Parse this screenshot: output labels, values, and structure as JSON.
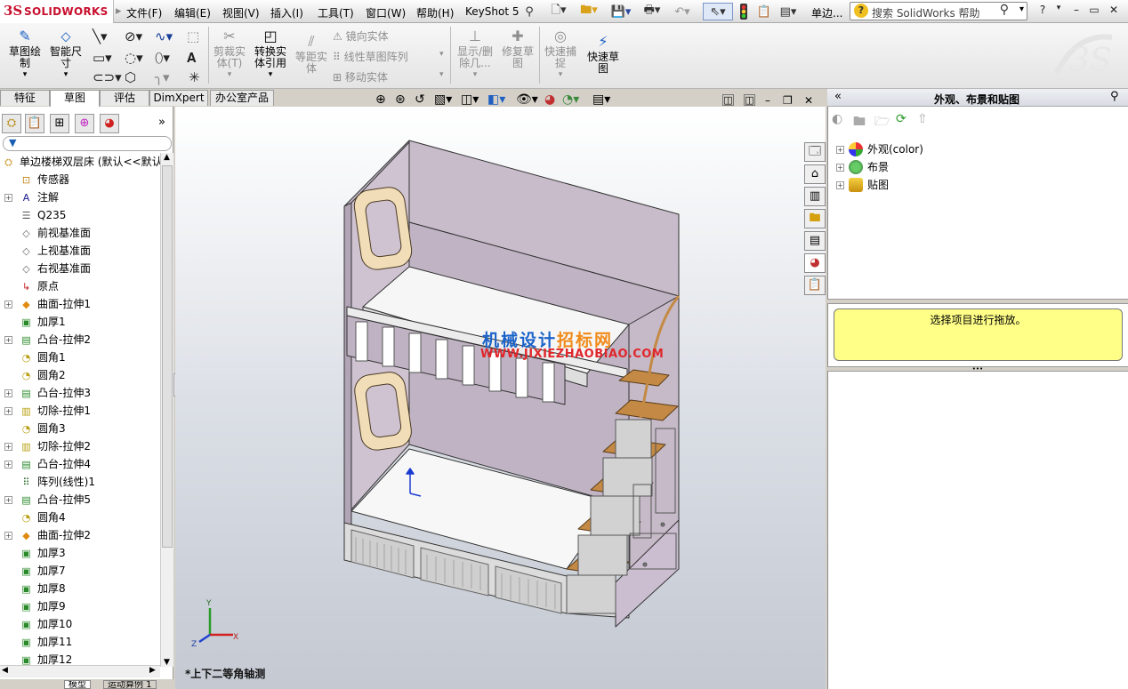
{
  "app": {
    "logo_mark": "3S",
    "logo_text": "SOLIDWORKS"
  },
  "menu": [
    "文件(F)",
    "编辑(E)",
    "视图(V)",
    "插入(I)",
    "工具(T)",
    "窗口(W)",
    "帮助(H)",
    "KeyShot 5"
  ],
  "toolbar": {
    "model_name_short": "单边...",
    "search_placeholder": "搜索 SolidWorks 帮助"
  },
  "command_manager": {
    "sketch": "草图绘\n制",
    "smart_dim": "智能尺\n寸",
    "trim": "剪裁实\n体(T)",
    "convert": "转换实\n体引用",
    "offset": "等距实\n体",
    "mirror": "镜向实体",
    "linear_pattern": "线性草图阵列",
    "move": "移动实体",
    "show_delete": "显示/删\n除几...",
    "repair": "修复草\n图",
    "quick_snap": "快速捕\n捉",
    "rapid_sketch": "快速草\n图"
  },
  "tabs": [
    "特征",
    "草图",
    "评估",
    "DimXpert",
    "办公室产品"
  ],
  "active_tab": 1,
  "tree": {
    "root": "单边楼梯双层床  (默认<<默认",
    "items": [
      {
        "label": "传感器",
        "exp": false,
        "icon": "sensor-icon"
      },
      {
        "label": "注解",
        "exp": true,
        "icon": "annotation-icon"
      },
      {
        "label": "Q235",
        "exp": false,
        "icon": "material-icon"
      },
      {
        "label": "前视基准面",
        "exp": false,
        "icon": "plane-icon"
      },
      {
        "label": "上视基准面",
        "exp": false,
        "icon": "plane-icon"
      },
      {
        "label": "右视基准面",
        "exp": false,
        "icon": "plane-icon"
      },
      {
        "label": "原点",
        "exp": false,
        "icon": "origin-icon"
      },
      {
        "label": "曲面-拉伸1",
        "exp": true,
        "icon": "surface-extrude-icon"
      },
      {
        "label": "加厚1",
        "exp": false,
        "icon": "thicken-icon"
      },
      {
        "label": "凸台-拉伸2",
        "exp": true,
        "icon": "boss-extrude-icon"
      },
      {
        "label": "圆角1",
        "exp": false,
        "icon": "fillet-icon"
      },
      {
        "label": "圆角2",
        "exp": false,
        "icon": "fillet-icon"
      },
      {
        "label": "凸台-拉伸3",
        "exp": true,
        "icon": "boss-extrude-icon"
      },
      {
        "label": "切除-拉伸1",
        "exp": true,
        "icon": "cut-extrude-icon"
      },
      {
        "label": "圆角3",
        "exp": false,
        "icon": "fillet-icon"
      },
      {
        "label": "切除-拉伸2",
        "exp": true,
        "icon": "cut-extrude-icon"
      },
      {
        "label": "凸台-拉伸4",
        "exp": true,
        "icon": "boss-extrude-icon"
      },
      {
        "label": "阵列(线性)1",
        "exp": false,
        "icon": "linear-pattern-icon"
      },
      {
        "label": "凸台-拉伸5",
        "exp": true,
        "icon": "boss-extrude-icon"
      },
      {
        "label": "圆角4",
        "exp": false,
        "icon": "fillet-icon"
      },
      {
        "label": "曲面-拉伸2",
        "exp": true,
        "icon": "surface-extrude-icon"
      },
      {
        "label": "加厚3",
        "exp": false,
        "icon": "thicken-icon"
      },
      {
        "label": "加厚7",
        "exp": false,
        "icon": "thicken-icon"
      },
      {
        "label": "加厚8",
        "exp": false,
        "icon": "thicken-icon"
      },
      {
        "label": "加厚9",
        "exp": false,
        "icon": "thicken-icon"
      },
      {
        "label": "加厚10",
        "exp": false,
        "icon": "thicken-icon"
      },
      {
        "label": "加厚11",
        "exp": false,
        "icon": "thicken-icon"
      },
      {
        "label": "加厚12",
        "exp": false,
        "icon": "thicken-icon"
      }
    ]
  },
  "bottom_tabs": [
    "模型",
    "运动算例 1"
  ],
  "viewport": {
    "view_name": "*上下二等角轴测",
    "watermark_a": "机械设计",
    "watermark_b": "招标网",
    "watermark_url": "WWW.JIXIEZHAOBIAO.COM",
    "axis_x": "X",
    "axis_y": "Y",
    "axis_z": "Z"
  },
  "task_pane": {
    "title": "外观、布景和贴图",
    "items": [
      {
        "label": "外观(color)",
        "icon": "appearance-icon"
      },
      {
        "label": "布景",
        "icon": "scene-icon"
      },
      {
        "label": "贴图",
        "icon": "decal-icon"
      }
    ],
    "hint": "选择项目进行拖放。"
  },
  "colors": {
    "accent": "#c8102e",
    "hint_bg": "#ffff88",
    "panel": "#c8bccb"
  }
}
